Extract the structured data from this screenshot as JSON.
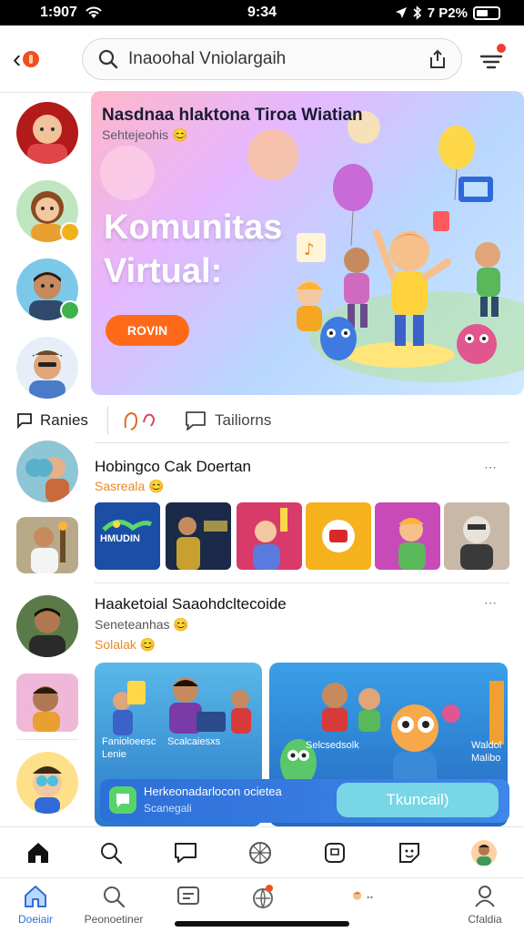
{
  "status_bar": {
    "time_left": "1:907",
    "time_center": "9:34",
    "battery_text": "7 P2%"
  },
  "search": {
    "value": "Inaoohal Vniolargaih"
  },
  "banner": {
    "title": "Nasdnaa hlaktona Tiroa Wiatian",
    "subtitle": "Sehtejeohis",
    "headline": "Komunitas Virtual:",
    "cta_label": "ROVIN"
  },
  "tabs": [
    {
      "label": "Ranies"
    },
    {
      "label": "Tailiorns"
    }
  ],
  "posts": [
    {
      "name": "Hobingco Cak Doertan",
      "sub1": "Sasreala",
      "menu": "⋯"
    },
    {
      "name": "Haaketoial Saaohdcltecoide",
      "sub1": "Seneteanhas",
      "sub2": "Solalak",
      "menu": "⋯"
    }
  ],
  "thumbnails": [
    {
      "caption": "HMUDIN"
    }
  ],
  "cards": [
    {
      "caption1": "Fanioloeesc",
      "caption2": "Scalcaiesxs",
      "caption3": "Lenie"
    },
    {
      "caption1": "Selcsedsolk",
      "caption2": "Waldol",
      "caption3": "Malibo"
    }
  ],
  "promo": {
    "title": "Herkeonadarlocon ocietea",
    "subtitle": "Scanegali",
    "button_label": "Tkuncail)"
  },
  "bottom_nav": [
    {
      "label": "Doeiair",
      "icon": "home-icon",
      "active": true
    },
    {
      "label": "Peonoetiner",
      "icon": "search-icon"
    },
    {
      "label": "",
      "icon": "message-board-icon"
    },
    {
      "label": "",
      "icon": "globe-badge-icon"
    },
    {
      "label": "",
      "icon": "profile-dots-icon"
    },
    {
      "label": "Cfaldia",
      "icon": "person-icon"
    }
  ],
  "colors": {
    "accent": "#2f6fd6",
    "cta": "#ff6a1a",
    "subtext_orange": "#e98a1c"
  }
}
